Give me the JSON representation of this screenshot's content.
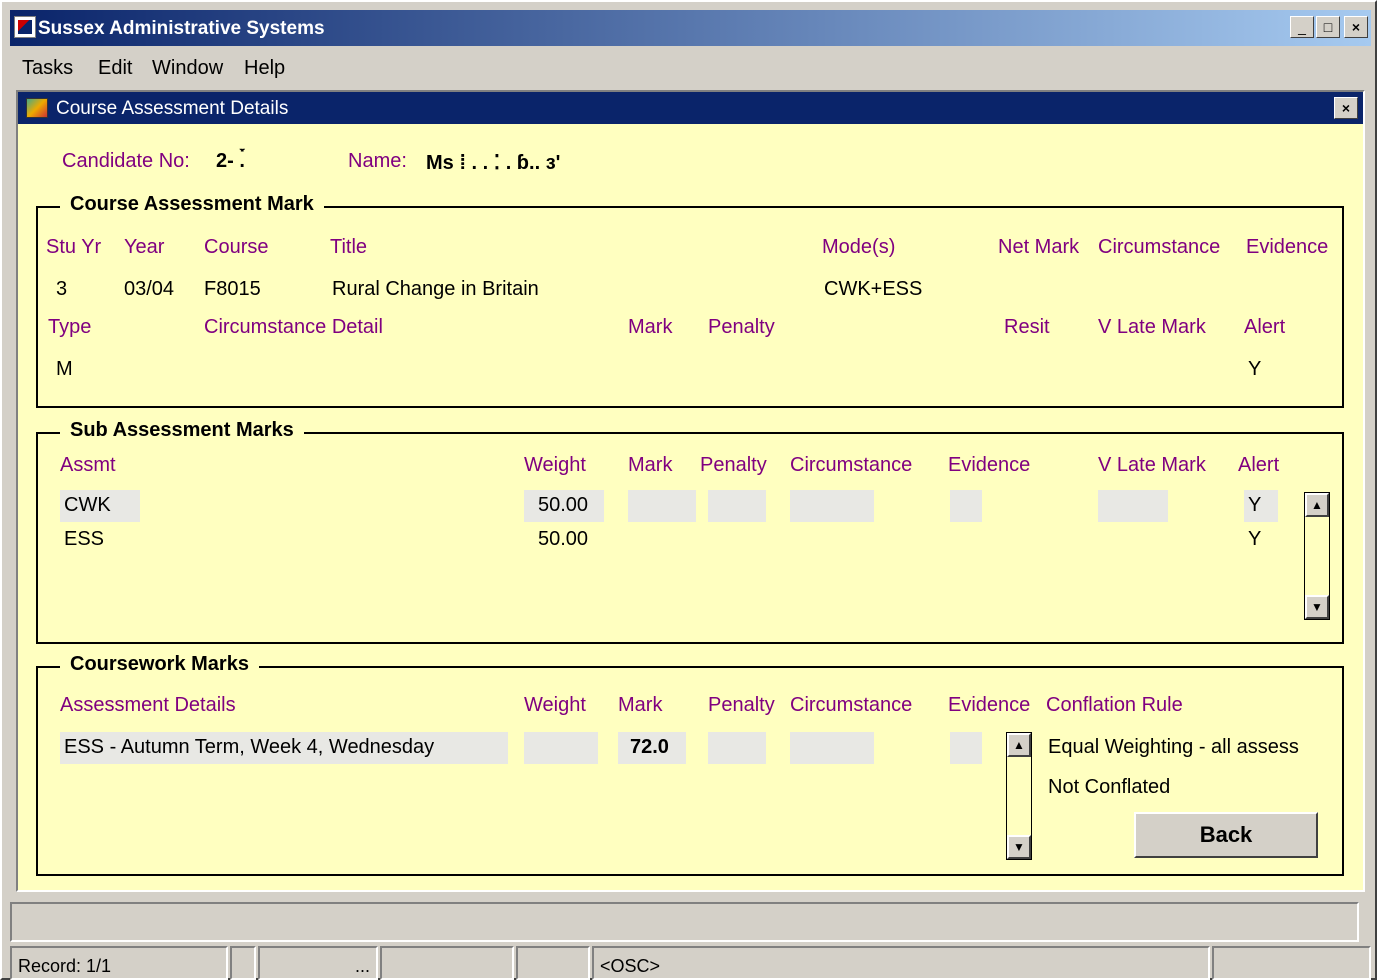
{
  "app": {
    "title": "Sussex Administrative Systems",
    "menu": [
      "Tasks",
      "Edit",
      "Window",
      "Help"
    ],
    "minimize": "_",
    "maximize": "□",
    "close": "×"
  },
  "window": {
    "title": "Course Assessment Details",
    "close": "×"
  },
  "candidate": {
    "no_label": "Candidate No:",
    "no_value": "2-  .́̀",
    "name_label": "Name:",
    "name_value": "Ms ⁞  .  . ⁚ . ɓ.. ɜ'"
  },
  "course_assessment": {
    "group_title": "Course Assessment Mark",
    "headers1": {
      "stu_yr": "Stu Yr",
      "year": "Year",
      "course": "Course",
      "title": "Title",
      "modes": "Mode(s)",
      "net_mark": "Net Mark",
      "circumstance": "Circumstance",
      "evidence": "Evidence"
    },
    "row1": {
      "stu_yr": "3",
      "year": "03/04",
      "course": "F8015",
      "title": "Rural Change in Britain",
      "modes": "CWK+ESS"
    },
    "headers2": {
      "type": "Type",
      "circ_detail": "Circumstance Detail",
      "mark": "Mark",
      "penalty": "Penalty",
      "resit": "Resit",
      "v_late_mark": "V Late Mark",
      "alert": "Alert"
    },
    "row2": {
      "type": "M",
      "alert": "Y"
    }
  },
  "sub_assessment": {
    "group_title": "Sub Assessment Marks",
    "headers": {
      "assmt": "Assmt",
      "weight": "Weight",
      "mark": "Mark",
      "penalty": "Penalty",
      "circumstance": "Circumstance",
      "evidence": "Evidence",
      "v_late_mark": "V Late Mark",
      "alert": "Alert"
    },
    "rows": [
      {
        "assmt": "CWK",
        "weight": "50.00",
        "alert": "Y"
      },
      {
        "assmt": "ESS",
        "weight": "50.00",
        "alert": "Y"
      }
    ]
  },
  "coursework": {
    "group_title": "Coursework Marks",
    "headers": {
      "details": "Assessment Details",
      "weight": "Weight",
      "mark": "Mark",
      "penalty": "Penalty",
      "circumstance": "Circumstance",
      "evidence": "Evidence",
      "conflation": "Conflation Rule"
    },
    "row": {
      "details": "ESS - Autumn Term, Week 4, Wednesday",
      "mark": "72.0"
    },
    "conflation_rules": [
      "Equal Weighting - all assess",
      "Not Conflated"
    ],
    "back_label": "Back"
  },
  "status": {
    "record": "Record: 1/1",
    "ellipsis": "...",
    "mode": "<OSC>"
  },
  "icons": {
    "up": "▲",
    "down": "▼"
  }
}
